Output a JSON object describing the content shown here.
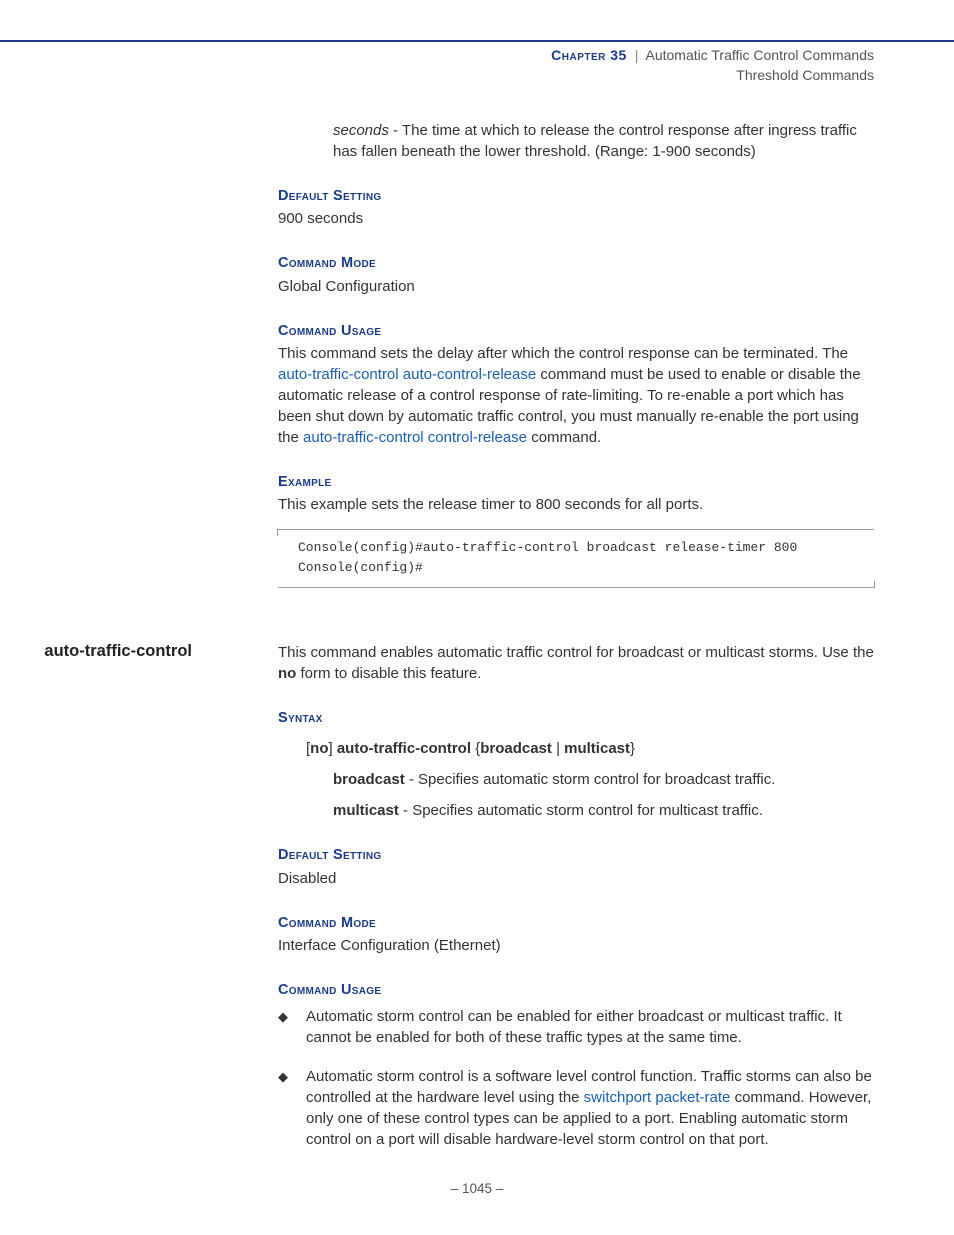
{
  "header": {
    "chapter_label": "Chapter 35",
    "chapter_title": "Automatic Traffic Control Commands",
    "subtitle": "Threshold Commands"
  },
  "section1": {
    "param": {
      "name": "seconds",
      "desc": " - The time at which to release the control response after ingress traffic has fallen beneath the lower threshold. (Range: 1-900 seconds)"
    },
    "default_heading": "Default Setting",
    "default_value": "900 seconds",
    "mode_heading": "Command Mode",
    "mode_value": "Global Configuration",
    "usage_heading": "Command Usage",
    "usage_pre": "This command sets the delay after which the control response can be terminated. The ",
    "usage_link1": "auto-traffic-control auto-control-release",
    "usage_mid": " command must be used to enable or disable the automatic release of a control response of rate-limiting. To re-enable a port which has been shut down by automatic traffic control, you must manually re-enable the port using the ",
    "usage_link2": "auto-traffic-control control-release",
    "usage_post": " command.",
    "example_heading": "Example",
    "example_text": "This example sets the release timer to 800 seconds for all ports.",
    "code": "Console(config)#auto-traffic-control broadcast release-timer 800\nConsole(config)#"
  },
  "section2": {
    "margin_label": "auto-traffic-control",
    "intro_pre": "This command enables automatic traffic control for broadcast or multicast storms. Use the ",
    "intro_bold": "no",
    "intro_post": " form to disable this feature.",
    "syntax_heading": "Syntax",
    "syntax": {
      "lb": "[",
      "no": "no",
      "rb": "] ",
      "cmd": "auto-traffic-control",
      "lc": " {",
      "b1": "broadcast",
      "pipe": " | ",
      "b2": "multicast",
      "rc": "}"
    },
    "param1": {
      "name": "broadcast",
      "desc": " - Specifies automatic storm control for broadcast traffic."
    },
    "param2": {
      "name": "multicast",
      "desc": " - Specifies automatic storm control for multicast traffic."
    },
    "default_heading": "Default Setting",
    "default_value": "Disabled",
    "mode_heading": "Command Mode",
    "mode_value": "Interface Configuration (Ethernet)",
    "usage_heading": "Command Usage",
    "bullet1": "Automatic storm control can be enabled for either broadcast or multicast traffic. It cannot be enabled for both of these traffic types at the same time.",
    "bullet2_pre": "Automatic storm control is a software level control function. Traffic storms can also be controlled at the hardware level using the ",
    "bullet2_link": "switchport packet-rate",
    "bullet2_post": " command. However, only one of these control types can be applied to a port. Enabling automatic storm control on a port will disable hardware-level storm control on that port."
  },
  "footer": {
    "dash": "–  ",
    "page": "1045",
    "dash2": "  –"
  }
}
